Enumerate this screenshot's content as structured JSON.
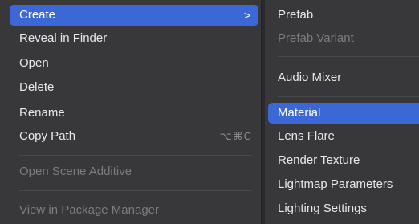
{
  "left_menu": {
    "create_label": "Create",
    "create_chevron": ">",
    "reveal_label": "Reveal in Finder",
    "open_label": "Open",
    "delete_label": "Delete",
    "rename_label": "Rename",
    "copy_path_label": "Copy Path",
    "copy_path_shortcut": "⌥⌘C",
    "open_scene_additive_label": "Open Scene Additive",
    "view_package_manager_label": "View in Package Manager"
  },
  "right_menu": {
    "prefab_label": "Prefab",
    "prefab_variant_label": "Prefab Variant",
    "audio_mixer_label": "Audio Mixer",
    "material_label": "Material",
    "lens_flare_label": "Lens Flare",
    "render_texture_label": "Render Texture",
    "lightmap_parameters_label": "Lightmap Parameters",
    "lighting_settings_label": "Lighting Settings"
  },
  "colors": {
    "highlight": "#3b68d6",
    "menu_bg": "#38383a",
    "disabled_text": "#7c7c80"
  }
}
